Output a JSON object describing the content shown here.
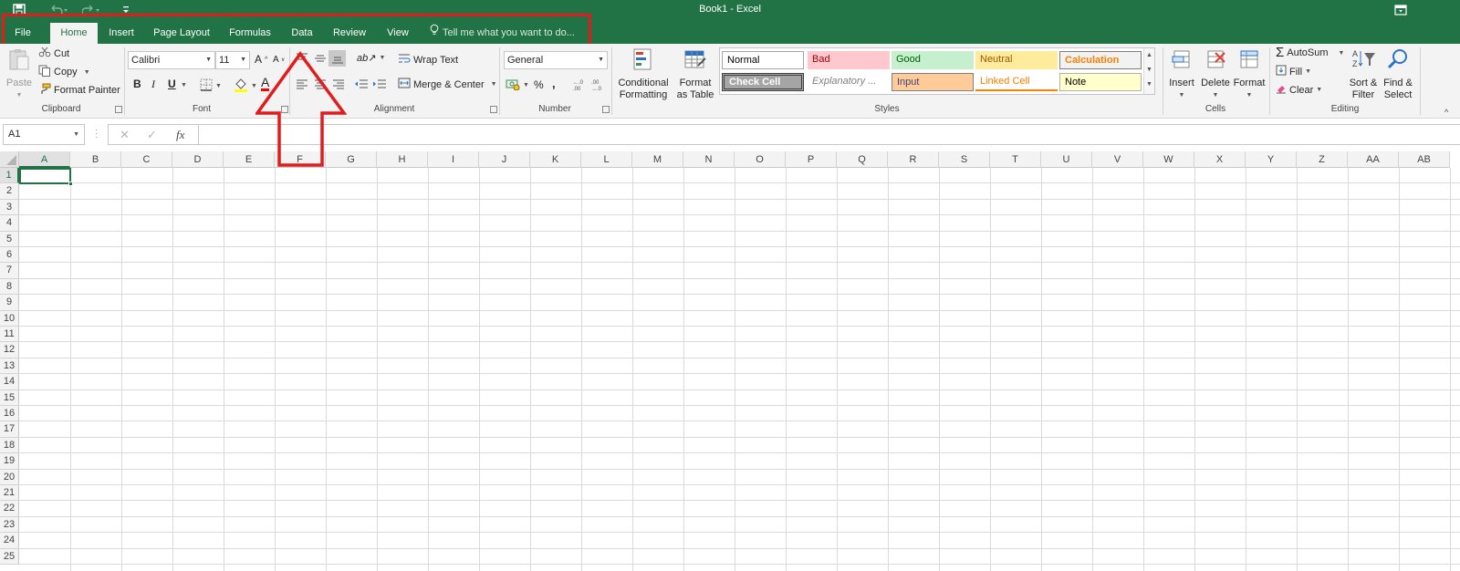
{
  "window": {
    "title": "Book1 - Excel"
  },
  "colors": {
    "brand": "#217346",
    "highlight": "#e21c1c"
  },
  "qat": {
    "icons": [
      "save-icon",
      "undo-icon",
      "redo-icon",
      "customize-qat-icon"
    ]
  },
  "tabs": [
    {
      "label": "File"
    },
    {
      "label": "Home",
      "active": true
    },
    {
      "label": "Insert"
    },
    {
      "label": "Page Layout"
    },
    {
      "label": "Formulas"
    },
    {
      "label": "Data"
    },
    {
      "label": "Review"
    },
    {
      "label": "View"
    }
  ],
  "tellme": {
    "placeholder": "Tell me what you want to do..."
  },
  "ribbon": {
    "clipboard": {
      "label": "Clipboard",
      "paste": "Paste",
      "cut": "Cut",
      "copy": "Copy",
      "format_painter": "Format Painter"
    },
    "font": {
      "label": "Font",
      "font_name": "Calibri",
      "font_size": "11",
      "bold": "B",
      "italic": "I",
      "underline": "U",
      "font_color": "A"
    },
    "alignment": {
      "label": "Alignment",
      "wrap_text": "Wrap Text",
      "merge_center": "Merge & Center"
    },
    "number": {
      "label": "Number",
      "format": "General",
      "percent": "%",
      "comma": ","
    },
    "styles": {
      "label": "Styles",
      "conditional_formatting": "Conditional Formatting",
      "format_as_table": "Format as Table",
      "cells": [
        {
          "label": "Normal",
          "bg": "#ffffff",
          "fg": "#000000"
        },
        {
          "label": "Bad",
          "bg": "#ffc7ce",
          "fg": "#9c0006"
        },
        {
          "label": "Good",
          "bg": "#c6efce",
          "fg": "#006100"
        },
        {
          "label": "Neutral",
          "bg": "#ffeb9c",
          "fg": "#9c5700"
        },
        {
          "label": "Calculation",
          "bg": "#f2f2f2",
          "fg": "#fa7d00"
        },
        {
          "label": "Check Cell",
          "bg": "#a5a5a5",
          "fg": "#ffffff"
        },
        {
          "label": "Explanatory ...",
          "bg": "#ffffff",
          "fg": "#7f7f7f"
        },
        {
          "label": "Input",
          "bg": "#ffcc99",
          "fg": "#3f3f76"
        },
        {
          "label": "Linked Cell",
          "bg": "#ffffff",
          "fg": "#fa7d00"
        },
        {
          "label": "Note",
          "bg": "#ffffcc",
          "fg": "#000000"
        }
      ]
    },
    "cells": {
      "label": "Cells",
      "insert": "Insert",
      "delete": "Delete",
      "format": "Format"
    },
    "editing": {
      "label": "Editing",
      "autosum": "AutoSum",
      "fill": "Fill",
      "clear": "Clear",
      "sort_filter": "Sort & Filter",
      "find_select": "Find & Select"
    }
  },
  "formula_bar": {
    "name_box": "A1",
    "fx": "fx",
    "formula": ""
  },
  "grid": {
    "columns": [
      "A",
      "B",
      "C",
      "D",
      "E",
      "F",
      "G",
      "H",
      "I",
      "J",
      "K",
      "L",
      "M",
      "N",
      "O",
      "P",
      "Q",
      "R",
      "S",
      "T",
      "U",
      "V",
      "W",
      "X",
      "Y",
      "Z",
      "AA",
      "AB"
    ],
    "rows": [
      "1",
      "2",
      "3",
      "4",
      "5",
      "6",
      "7",
      "8",
      "9",
      "10",
      "11",
      "12",
      "13",
      "14",
      "15",
      "16",
      "17",
      "18",
      "19",
      "20",
      "21",
      "22",
      "23",
      "24",
      "25"
    ],
    "active_cell": "A1"
  }
}
